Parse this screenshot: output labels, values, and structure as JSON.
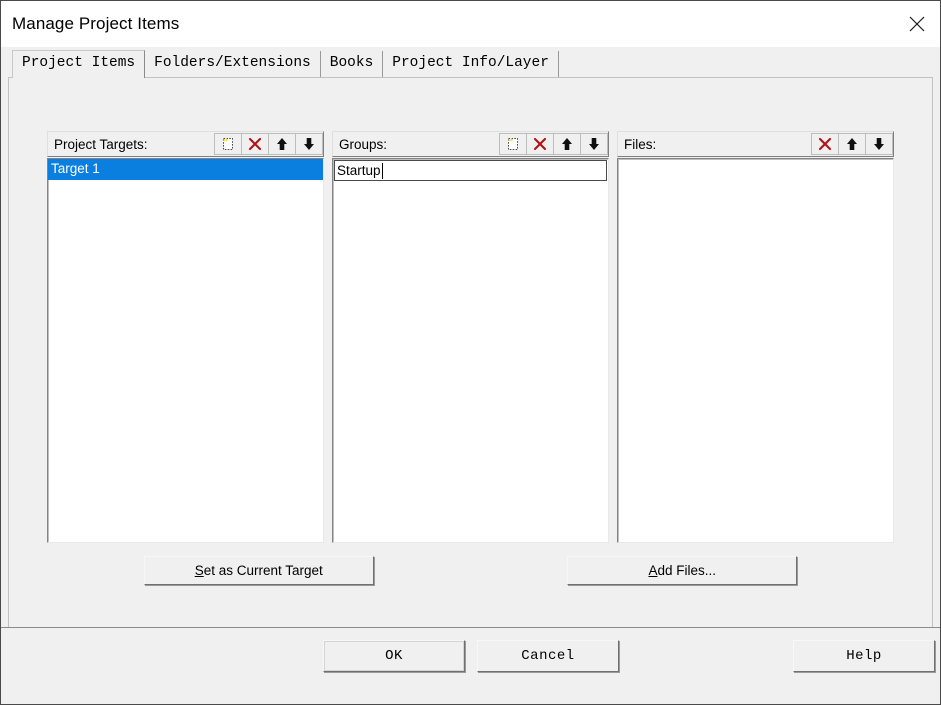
{
  "window": {
    "title": "Manage Project Items",
    "close_icon": "close-icon"
  },
  "tabs": [
    {
      "label": "Project Items",
      "selected": true
    },
    {
      "label": "Folders/Extensions",
      "selected": false
    },
    {
      "label": "Books",
      "selected": false
    },
    {
      "label": "Project Info/Layer",
      "selected": false
    }
  ],
  "panels": {
    "targets": {
      "label": "Project Targets:",
      "tools": [
        "new-item-icon",
        "delete-icon",
        "move-up-icon",
        "move-down-icon"
      ],
      "items": [
        {
          "text": "Target 1",
          "selected": true
        }
      ]
    },
    "groups": {
      "label": "Groups:",
      "tools": [
        "new-item-icon",
        "delete-icon",
        "move-up-icon",
        "move-down-icon"
      ],
      "edit_value": "Startup",
      "items": []
    },
    "files": {
      "label": "Files:",
      "tools": [
        "delete-icon",
        "move-up-icon",
        "move-down-icon"
      ],
      "items": []
    }
  },
  "actions": {
    "set_current_target": {
      "prefix": "S",
      "rest": "et as Current Target"
    },
    "add_files": {
      "prefix": "A",
      "rest": "dd Files..."
    }
  },
  "footer": {
    "ok": "OK",
    "cancel": "Cancel",
    "help": "Help"
  },
  "colors": {
    "selection_blue": "#0a7fe0",
    "delete_red": "#b01515",
    "dialog_bg": "#f0f0f0",
    "titlebar_bg": "#ffffff"
  }
}
